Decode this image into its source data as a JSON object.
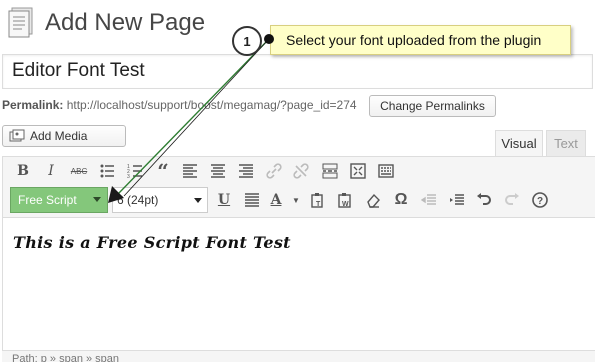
{
  "header": {
    "title": "Add New Page"
  },
  "callout": {
    "number": "1",
    "text": "Select your font uploaded from the plugin"
  },
  "post_title": {
    "value": "Editor Font Test"
  },
  "permalink": {
    "label": "Permalink:",
    "url": "http://localhost/support/boost/megamag/?page_id=274",
    "change_label": "Change Permalinks"
  },
  "media": {
    "add_label": "Add Media"
  },
  "tabs": {
    "visual": "Visual",
    "text": "Text"
  },
  "toolbar": {
    "font_family": "Free Script",
    "font_size": "6 (24pt)",
    "bold": "B",
    "italic": "I",
    "strikethrough": "ABC",
    "underline": "U",
    "text_color": "A",
    "special_char": "Ω"
  },
  "editor": {
    "content": "This is a Free Script Font Test"
  },
  "status": {
    "path": "Path: p » span » span"
  },
  "colors": {
    "font_select_bg": "#84c77b",
    "callout_bg": "#ffffc8",
    "arrow": "#2e7d32"
  }
}
